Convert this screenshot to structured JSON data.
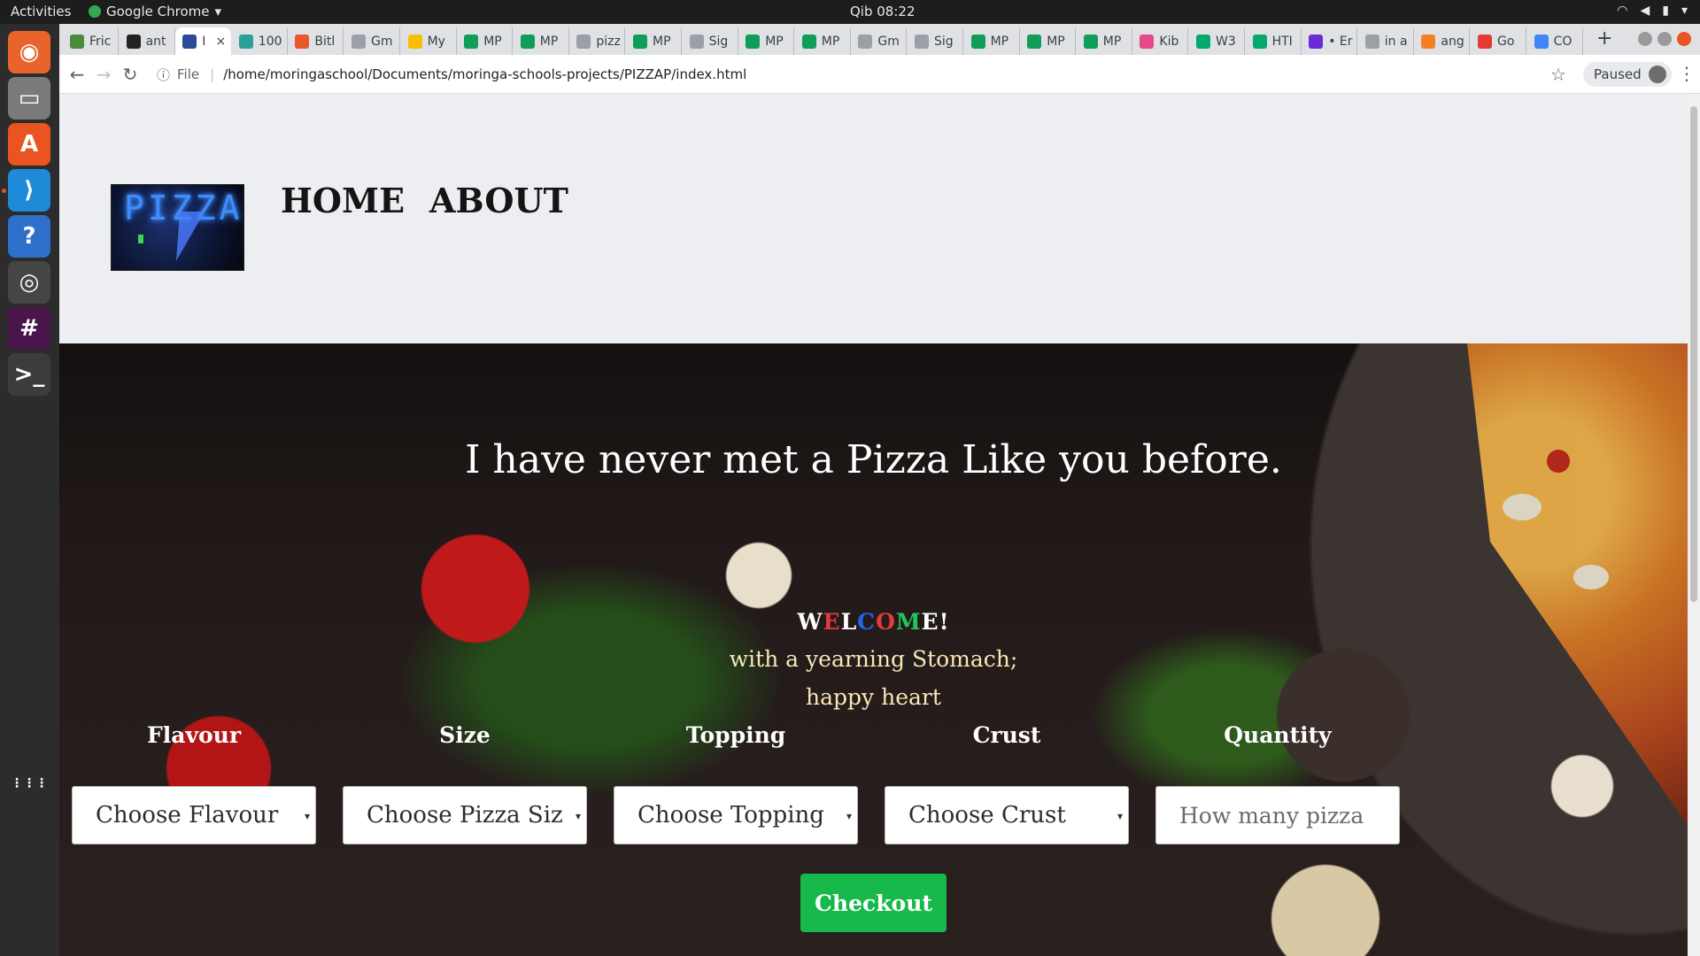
{
  "topbar": {
    "activities": "Activities",
    "app_name": "Google Chrome",
    "clock": "Qib 08:22",
    "tray_icons": [
      "wifi-icon",
      "volume-icon",
      "battery-icon",
      "caret-down-icon"
    ]
  },
  "dock": [
    {
      "name": "firefox-icon",
      "glyph": "◉",
      "color": "#e8642b"
    },
    {
      "name": "files-icon",
      "glyph": "▭",
      "color": "#7a7a7a"
    },
    {
      "name": "software-center-icon",
      "glyph": "A",
      "color": "#e95420"
    },
    {
      "name": "vscode-icon",
      "glyph": "⟩",
      "color": "#1e8ad8"
    },
    {
      "name": "help-icon",
      "glyph": "?",
      "color": "#2d6fc9"
    },
    {
      "name": "chrome-icon",
      "glyph": "◎",
      "color": "#34a853"
    },
    {
      "name": "slack-icon",
      "glyph": "#",
      "color": "#4a154b"
    },
    {
      "name": "terminal-icon",
      "glyph": ">_",
      "color": "#3c3c3c"
    },
    {
      "name": "app-grid-icon",
      "glyph": "⋮⋮⋮",
      "color": "#2c2c2c"
    }
  ],
  "tabs": [
    {
      "label": "Fric",
      "color": "#4b8b3b"
    },
    {
      "label": "ant",
      "color": "#222222"
    },
    {
      "label": "I",
      "color": "#2b4a9a",
      "active": true
    },
    {
      "label": "100",
      "color": "#2aa198"
    },
    {
      "label": "Bitl",
      "color": "#e8572a"
    },
    {
      "label": "Gm",
      "color": "#9aa0a6"
    },
    {
      "label": "My",
      "color": "#fbbc04"
    },
    {
      "label": "MP",
      "color": "#0f9d58"
    },
    {
      "label": "MP",
      "color": "#0f9d58"
    },
    {
      "label": "pizz",
      "color": "#9aa0a6"
    },
    {
      "label": "MP",
      "color": "#0f9d58"
    },
    {
      "label": "Sig",
      "color": "#9aa0a6"
    },
    {
      "label": "MP",
      "color": "#0f9d58"
    },
    {
      "label": "MP",
      "color": "#0f9d58"
    },
    {
      "label": "Gm",
      "color": "#9aa0a6"
    },
    {
      "label": "Sig",
      "color": "#9aa0a6"
    },
    {
      "label": "MP",
      "color": "#0f9d58"
    },
    {
      "label": "MP",
      "color": "#0f9d58"
    },
    {
      "label": "MP",
      "color": "#0f9d58"
    },
    {
      "label": "Kib",
      "color": "#e8478b"
    },
    {
      "label": "W3",
      "color": "#04aa6d"
    },
    {
      "label": "HTI",
      "color": "#04aa6d"
    },
    {
      "label": "• Er",
      "color": "#6c2bd9"
    },
    {
      "label": "in a",
      "color": "#9aa0a6"
    },
    {
      "label": "ang",
      "color": "#f48024"
    },
    {
      "label": "Go",
      "color": "#e53935"
    },
    {
      "label": "CO",
      "color": "#4285f4"
    }
  ],
  "address": {
    "file_label": "File",
    "url": "/home/moringaschool/Documents/moringa-schools-projects/PIZZAP/index.html"
  },
  "profile": {
    "label": "Paused"
  },
  "site": {
    "logo_text": "PIZZA",
    "nav": [
      "HOME",
      "ABOUT"
    ],
    "heading": "I have never met a Pizza Like you before.",
    "welcome_parts": [
      {
        "text": "W",
        "cls": ""
      },
      {
        "text": "E",
        "cls": "r"
      },
      {
        "text": "L",
        "cls": ""
      },
      {
        "text": "C",
        "cls": "b"
      },
      {
        "text": "O",
        "cls": "r"
      },
      {
        "text": "M",
        "cls": "g"
      },
      {
        "text": "E!",
        "cls": ""
      }
    ],
    "tagline1": "with a yearning Stomach;",
    "tagline2": "happy heart",
    "labels": {
      "flavour": "Flavour",
      "size": "Size",
      "topping": "Topping",
      "crust": "Crust",
      "quantity": "Quantity"
    },
    "selects": {
      "flavour": "Choose Flavour",
      "size": "Choose Pizza Siz",
      "topping": "Choose Topping",
      "crust": "Choose Crust"
    },
    "quantity_placeholder": "How many pizza",
    "checkout": "Checkout"
  }
}
